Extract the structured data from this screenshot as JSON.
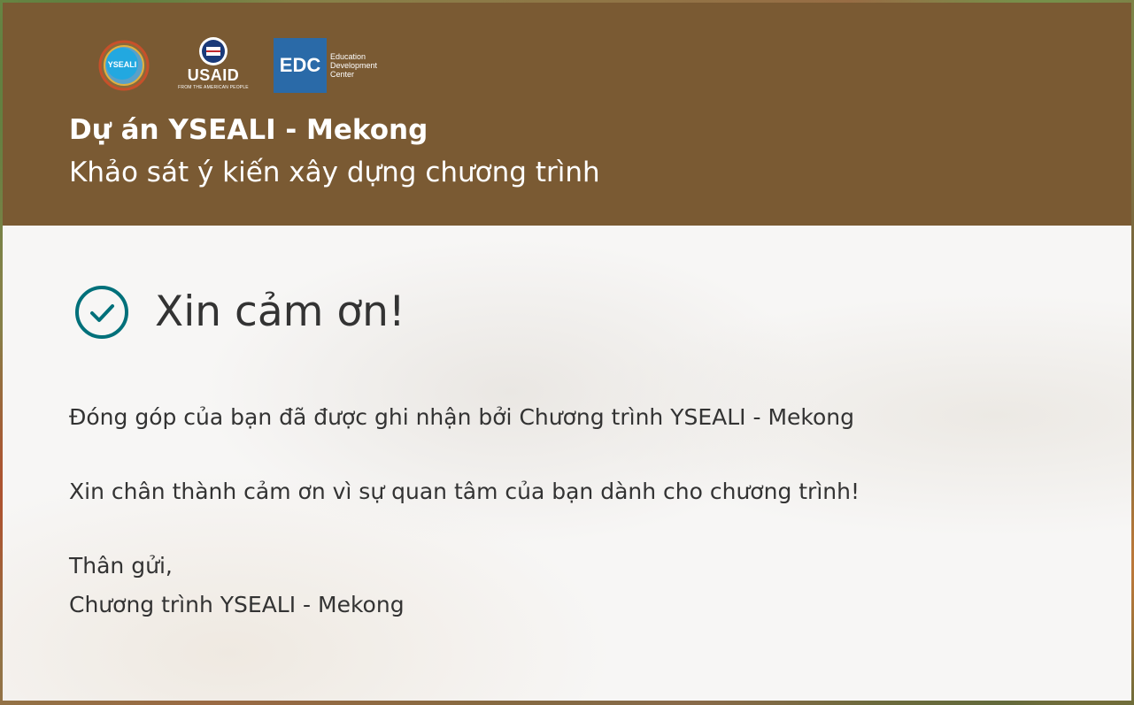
{
  "header": {
    "title": "Dự án YSEALI - Mekong",
    "subtitle": "Khảo sát ý kiến xây dựng chương trình",
    "background_color": "#7a5a33",
    "logos": {
      "yseali": "YSEALI",
      "usaid": "USAID",
      "usaid_tagline": "FROM THE AMERICAN PEOPLE",
      "edc_short": "EDC",
      "edc_full": [
        "Education",
        "Development",
        "Center"
      ]
    }
  },
  "confirmation": {
    "icon": "check-circle-icon",
    "icon_color": "#00707a",
    "heading": "Xin cảm ơn!",
    "message_1": "Đóng góp của bạn đã được ghi nhận bởi Chương trình YSEALI - Mekong",
    "message_2": "Xin chân thành cảm ơn vì sự quan tâm của bạn dành cho chương trình!",
    "closing": "Thân gửi,",
    "signature": "Chương trình YSEALI - Mekong"
  }
}
